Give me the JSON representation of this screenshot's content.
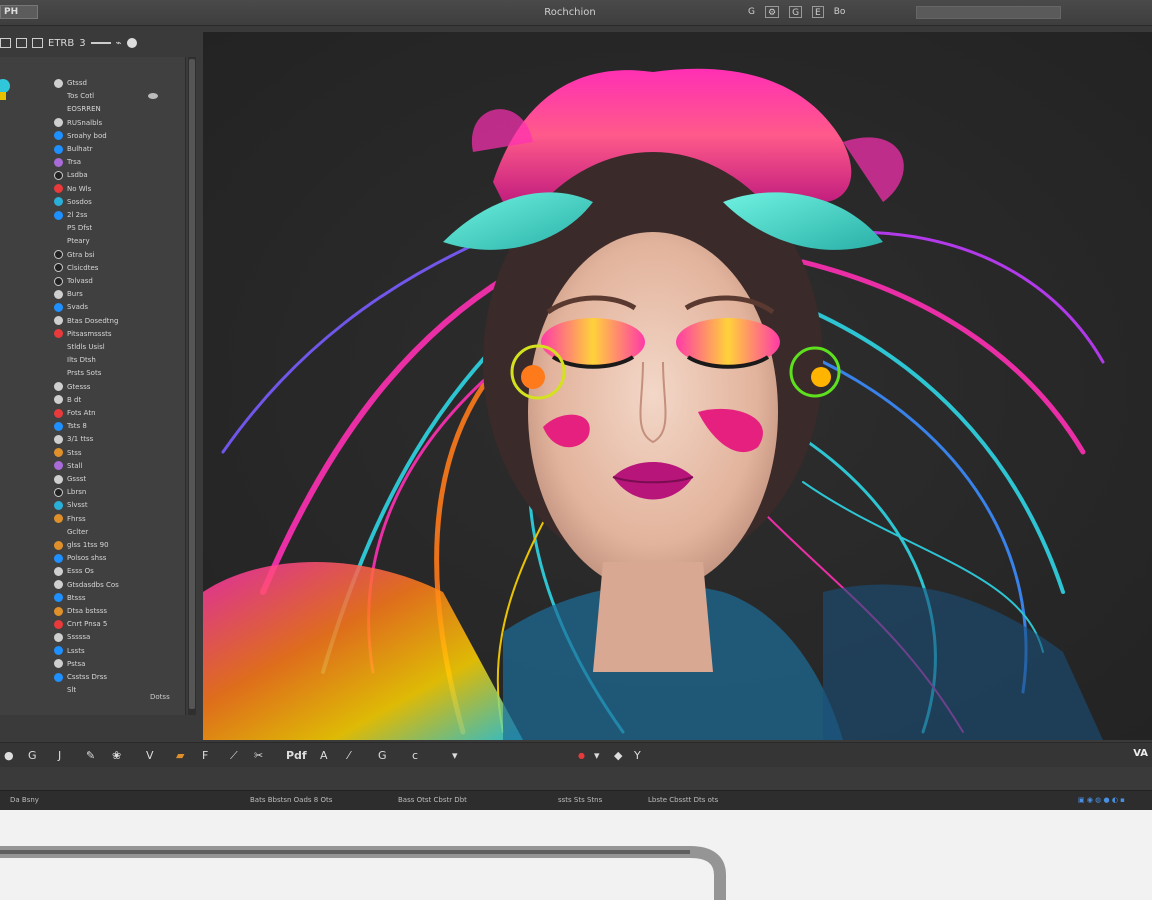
{
  "window": {
    "title": "Rochchion",
    "title_left_label": "PH"
  },
  "title_tools": [
    "G",
    "⚙",
    "G",
    "E",
    "Bo"
  ],
  "left_toolbar": {
    "labels": [
      "ETRB",
      "3"
    ]
  },
  "layers": [
    {
      "label": "Gtssd",
      "bullet": "plain"
    },
    {
      "label": "Tos Cotl",
      "bullet": "none"
    },
    {
      "label": "EOSRREN",
      "bullet": "none"
    },
    {
      "label": "RUSnalbls",
      "bullet": "plain"
    },
    {
      "label": "Sroahy bod",
      "bullet": "blue"
    },
    {
      "label": "Bulhatr",
      "bullet": "blue"
    },
    {
      "label": "Trsa",
      "bullet": "purple"
    },
    {
      "label": "Lsdba",
      "bullet": "dark"
    },
    {
      "label": "No Wls",
      "bullet": "red"
    },
    {
      "label": "Sosdos",
      "bullet": "teal"
    },
    {
      "label": "2l 2ss",
      "bullet": "blue"
    },
    {
      "label": "PS Dfst",
      "bullet": "none"
    },
    {
      "label": "Pteary",
      "bullet": "none"
    },
    {
      "label": "Gtra bsi",
      "bullet": "dark"
    },
    {
      "label": "Clsicdtes",
      "bullet": "dark"
    },
    {
      "label": "Tolvasd",
      "bullet": "dark"
    },
    {
      "label": "Burs",
      "bullet": "plain"
    },
    {
      "label": "Svads",
      "bullet": "blue"
    },
    {
      "label": "Btas Dosedtng",
      "bullet": "plain"
    },
    {
      "label": "Pitsasmsssts",
      "bullet": "red"
    },
    {
      "label": "Stldls Usisl",
      "bullet": "none"
    },
    {
      "label": "Ilts Dtsh",
      "bullet": "none"
    },
    {
      "label": "Prsts Sots",
      "bullet": "none"
    },
    {
      "label": "Gtesss",
      "bullet": "plain"
    },
    {
      "label": "B dt",
      "bullet": "plain"
    },
    {
      "label": "Fots Atn",
      "bullet": "red"
    },
    {
      "label": "Tsts 8",
      "bullet": "blue"
    },
    {
      "label": "3/1 ttss",
      "bullet": "plain"
    },
    {
      "label": "Stss",
      "bullet": "orange"
    },
    {
      "label": "Stall",
      "bullet": "purple"
    },
    {
      "label": "Gssst",
      "bullet": "plain"
    },
    {
      "label": "Lbrsn",
      "bullet": "dark"
    },
    {
      "label": "Slvsst",
      "bullet": "teal"
    },
    {
      "label": "Fhrss",
      "bullet": "orange"
    },
    {
      "label": "Gclter",
      "bullet": "none"
    },
    {
      "label": "glss 1tss 90",
      "bullet": "orange"
    },
    {
      "label": "Polsos shss",
      "bullet": "blue"
    },
    {
      "label": "Esss Os",
      "bullet": "plain"
    },
    {
      "label": "Gtsdasdbs Cos",
      "bullet": "plain"
    },
    {
      "label": "Btsss",
      "bullet": "blue"
    },
    {
      "label": "Dtsa bstsss",
      "bullet": "orange"
    },
    {
      "label": "Cnrt Pnsa 5",
      "bullet": "red"
    },
    {
      "label": "Sssssa",
      "bullet": "plain"
    },
    {
      "label": "Lssts",
      "bullet": "blue"
    },
    {
      "label": "Pstsa",
      "bullet": "plain"
    },
    {
      "label": "Csstss Drss",
      "bullet": "blue"
    },
    {
      "label": "Slt",
      "bullet": "none"
    }
  ],
  "panel_footer": "Dotss",
  "bottom_tools": [
    "G",
    "J",
    "V",
    "F",
    "Pdf",
    "A",
    "G",
    "c",
    "Y",
    "VA"
  ],
  "statusbar": {
    "left": "Da Bsny",
    "center1": "Bats Bbstsn Oads 8 Ots",
    "center2": "Bass Otst Cbstr Dbt",
    "center3": "ssts Sts Stns",
    "right": "Lbste Cbsstt Dts ots"
  },
  "colors": {
    "accent_blue": "#1e90ff",
    "magenta": "#ff2fb4",
    "cyan": "#2fd6e6"
  }
}
